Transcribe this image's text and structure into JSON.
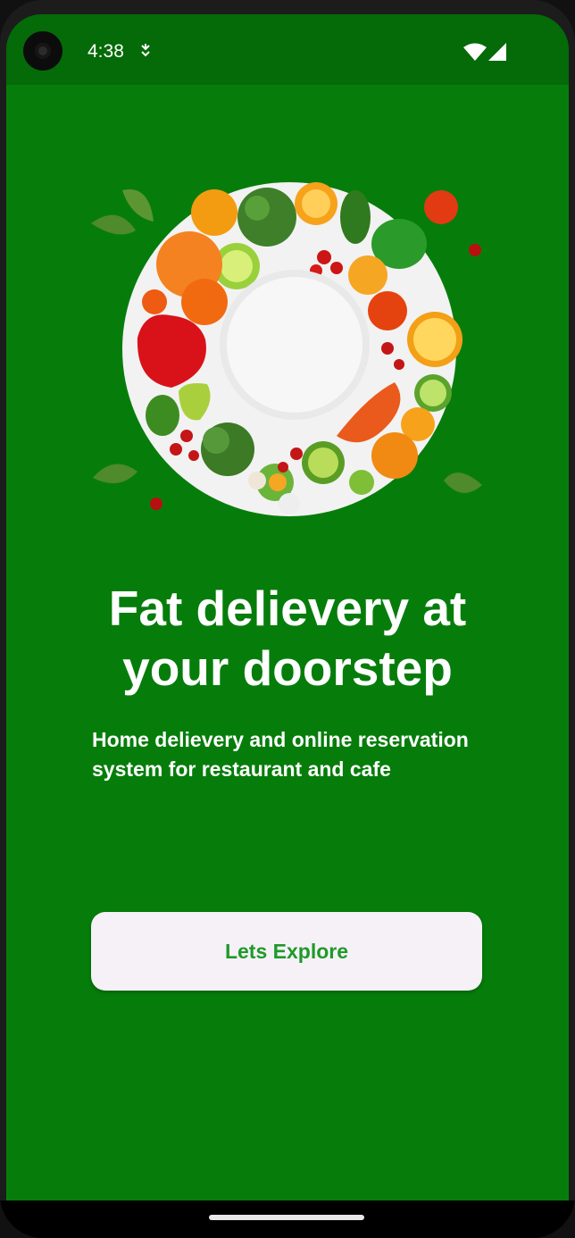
{
  "status_bar": {
    "time": "4:38",
    "icons": [
      "camera-icon",
      "download-icon",
      "wifi-icon",
      "signal-icon"
    ]
  },
  "hero": {
    "image": "vegetables-plate-illustration"
  },
  "content": {
    "headline": "Fat delievery at your doorstep",
    "subtitle": "Home delievery  and online reservation system for restaurant and cafe"
  },
  "actions": {
    "explore_label": "Lets Explore"
  },
  "colors": {
    "background": "#067d0b",
    "status_bar": "#056a08",
    "button_bg": "#f5f1f7",
    "button_text": "#1e9a28"
  }
}
